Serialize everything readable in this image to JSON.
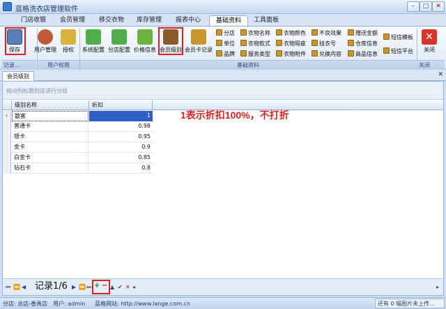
{
  "window": {
    "title": "蓝格洗衣店管理软件"
  },
  "tabs": [
    "门店收银",
    "会员管理",
    "移交衣物",
    "库存管理",
    "报表中心",
    "基础资料",
    "工具面板"
  ],
  "ribbon": {
    "groups": {
      "record": "记录...",
      "user_rights": "用户权限",
      "basic_data": "基础资料",
      "close": "关闭"
    },
    "save": "保存",
    "user_mgmt": "用户管理",
    "authorize": "授权",
    "system_config": "系统配置",
    "store_config": "分店配置",
    "price_info": "价格信息",
    "member_level": "会员级别",
    "member_card_record": "会员卡记录",
    "col1": [
      "分店",
      "单位",
      "品牌"
    ],
    "col2": [
      "衣物名称",
      "衣物款式",
      "服务类型"
    ],
    "col3": [
      "衣物颜色",
      "衣物瑕疵",
      "衣物附件"
    ],
    "col4": [
      "不良效果",
      "挂衣号",
      "兑换内容"
    ],
    "col5": [
      "赠送金额",
      "仓库信息",
      "商品信息"
    ],
    "col6": [
      "短信模板",
      "短信平台"
    ],
    "close_btn": "关闭"
  },
  "doc_tab": "会员级别",
  "grid": {
    "group_hint": "拖动列标题到这进行分组",
    "columns": [
      "级别名称",
      "折扣"
    ],
    "rows": [
      {
        "name": "散客",
        "discount": "1"
      },
      {
        "name": "普通卡",
        "discount": "0.98"
      },
      {
        "name": "银卡",
        "discount": "0.95"
      },
      {
        "name": "金卡",
        "discount": "0.9"
      },
      {
        "name": "白金卡",
        "discount": "0.85"
      },
      {
        "name": "钻石卡",
        "discount": "0.8"
      }
    ]
  },
  "annotation": "1表示折扣100%，不打折",
  "navigator": {
    "record": "记录1/6"
  },
  "status": {
    "store": "分店: 总店-香禹店",
    "user": "用户: admin",
    "website": "蓝格网站: http://www.lange.com.cn",
    "upload": "还有 0 幅图片未上传..."
  },
  "colors": {
    "highlight": "#e02020",
    "selected": "#2f5fc7"
  }
}
